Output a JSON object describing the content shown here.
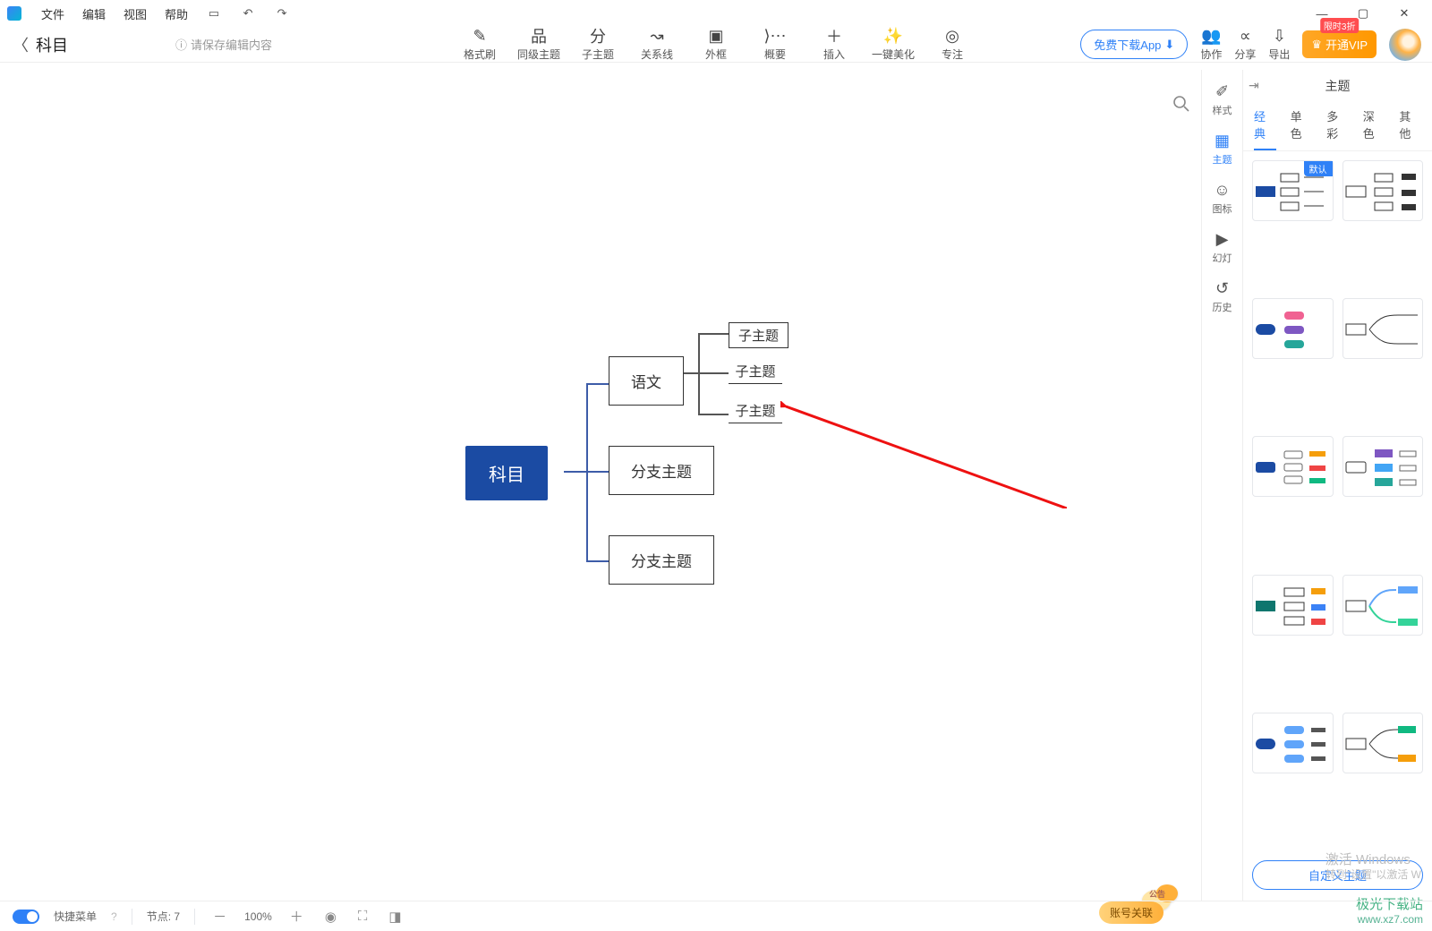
{
  "menu": {
    "items": [
      "文件",
      "编辑",
      "视图",
      "帮助"
    ]
  },
  "doc": {
    "title": "科目",
    "save_tip": "请保存编辑内容"
  },
  "toolbar": [
    "格式刷",
    "同级主题",
    "子主题",
    "关系线",
    "外框",
    "概要",
    "插入",
    "一键美化",
    "专注"
  ],
  "right_actions": [
    "协作",
    "分享",
    "导出"
  ],
  "download_app": "免费下载App",
  "vip": {
    "badge": "限时3折",
    "label": "开通VIP"
  },
  "mindmap": {
    "root": "科目",
    "branches": [
      "语文",
      "分支主题",
      "分支主题"
    ],
    "subs": [
      "子主题",
      "子主题",
      "子主题"
    ]
  },
  "right_panel": {
    "title": "主题",
    "vtabs": [
      "样式",
      "主题",
      "图标",
      "幻灯",
      "历史"
    ],
    "style_tabs": [
      "经典",
      "单色",
      "多彩",
      "深色",
      "其他"
    ],
    "default_badge": "默认",
    "custom_theme": "自定义主题"
  },
  "status": {
    "quickmenu": "快捷菜单",
    "nodes_label": "节点:",
    "nodes_value": "7",
    "zoom": "100%",
    "account_link": "账号关联"
  },
  "watermark": {
    "line1": "激活 Windows",
    "line2": "转到\"设置\"以激活 W",
    "site1": "极光下载站",
    "site2": "www.xz7.com"
  }
}
